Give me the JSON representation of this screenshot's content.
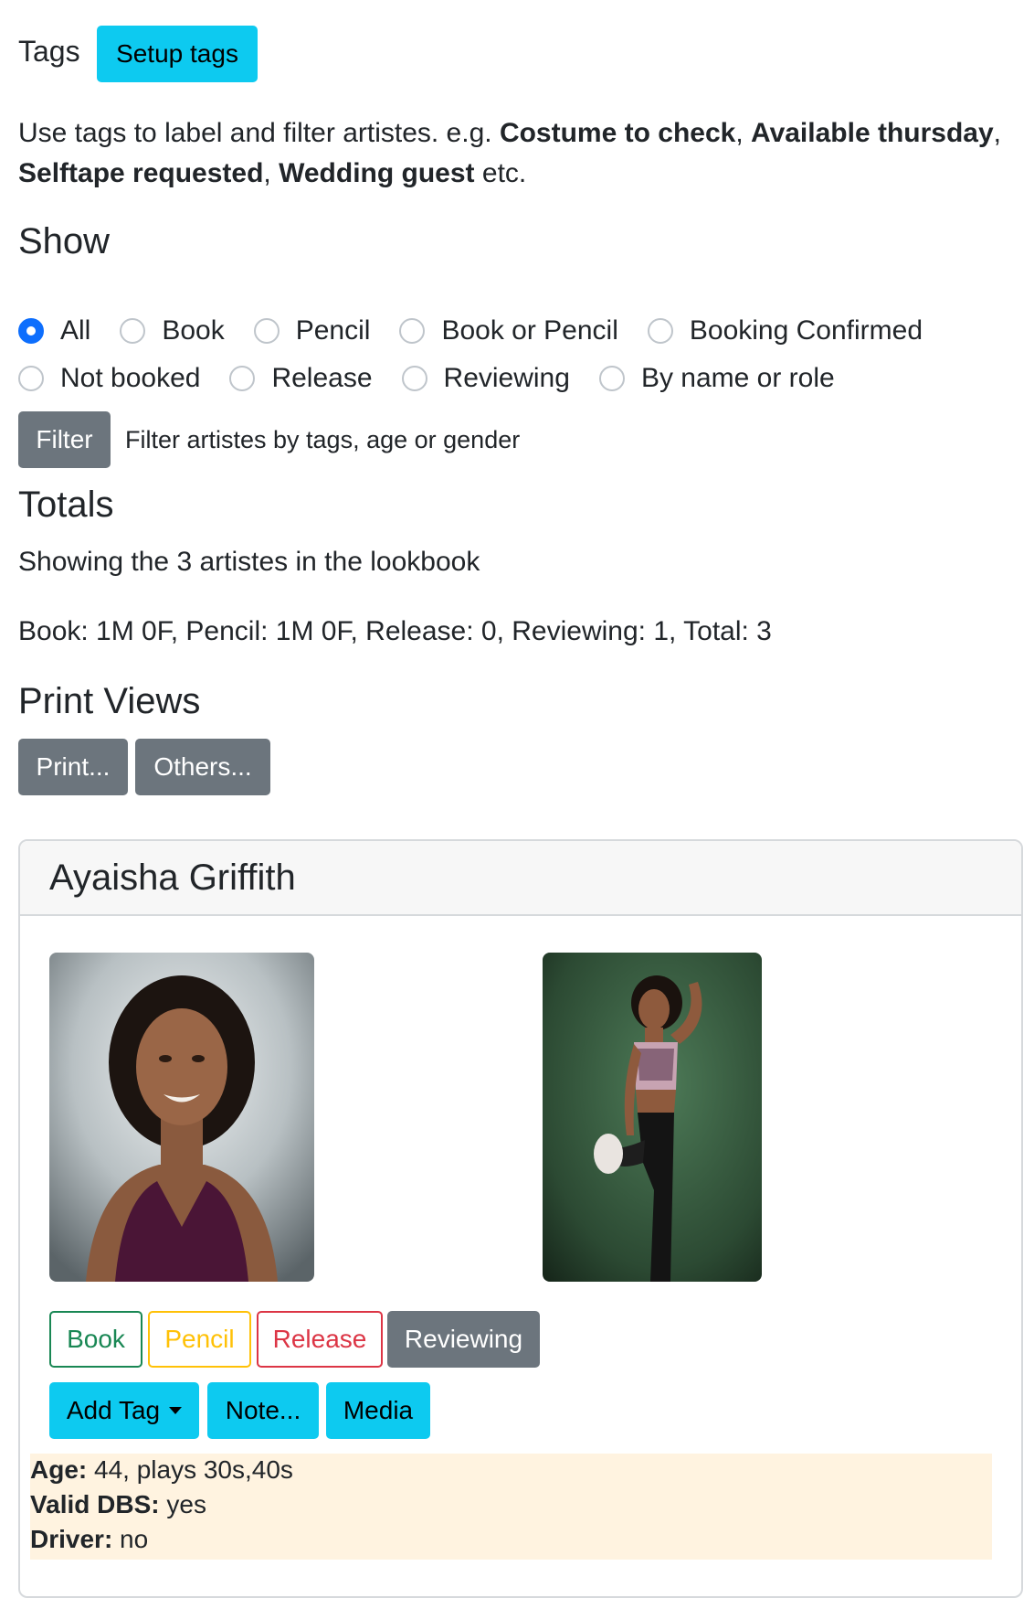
{
  "tags": {
    "label": "Tags",
    "setup_button": "Setup tags"
  },
  "intro": {
    "prefix": "Use tags to label and filter artistes. e.g. ",
    "example1": "Costume to check",
    "sep1": ", ",
    "example2": "Available thursday",
    "sep2": ", ",
    "example3": "Selftape requested",
    "sep3": ", ",
    "example4": "Wedding guest",
    "suffix": " etc."
  },
  "show": {
    "heading": "Show",
    "options": [
      "All",
      "Book",
      "Pencil",
      "Book or Pencil",
      "Booking Confirmed",
      "Not booked",
      "Release",
      "Reviewing",
      "By name or role"
    ],
    "selected": "All"
  },
  "filter": {
    "button": "Filter",
    "hint": "Filter artistes by tags, age or gender"
  },
  "totals": {
    "heading": "Totals",
    "showing": "Showing the 3 artistes in the lookbook",
    "summary": "Book: 1M 0F, Pencil: 1M 0F, Release: 0, Reviewing: 1, Total: 3"
  },
  "print_views": {
    "heading": "Print Views",
    "print_button": "Print...",
    "others_button": "Others..."
  },
  "artiste": {
    "name": "Ayaisha Griffith",
    "status_buttons": {
      "book": "Book",
      "pencil": "Pencil",
      "release": "Release",
      "reviewing": "Reviewing"
    },
    "actions": {
      "add_tag": "Add Tag",
      "note": "Note...",
      "media": "Media"
    },
    "details": {
      "age_label": "Age:",
      "age_value": " 44, plays 30s,40s",
      "dbs_label": "Valid DBS:",
      "dbs_value": " yes",
      "driver_label": "Driver:",
      "driver_value": " no"
    }
  },
  "colors": {
    "info": "#0dcaf0",
    "secondary": "#6c757d",
    "success": "#198754",
    "warning": "#ffc107",
    "danger": "#dc3545",
    "radio_checked": "#0d6efd",
    "details_bg": "#fff3e0"
  }
}
